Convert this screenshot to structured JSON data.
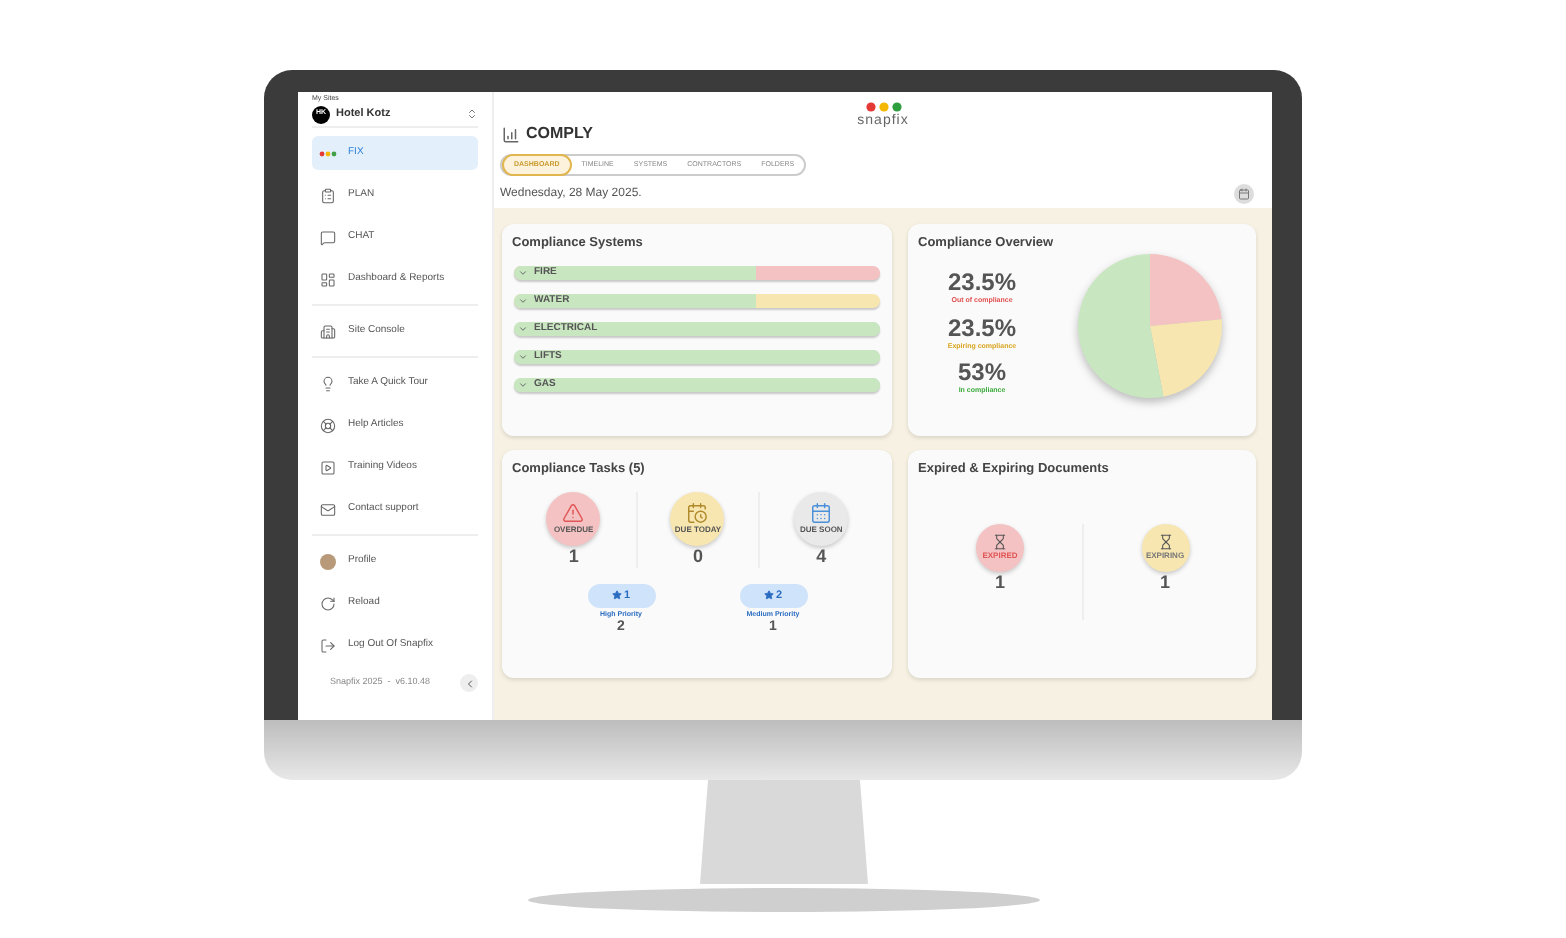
{
  "sidebar": {
    "site_label": "My Sites",
    "site_avatar": "HK",
    "site_name": "Hotel Kotz",
    "nav_groups": [
      [
        {
          "label": "FIX",
          "selected": true
        },
        {
          "label": "PLAN",
          "selected": false
        },
        {
          "label": "CHAT",
          "selected": false
        },
        {
          "label": "Dashboard & Reports",
          "selected": false
        }
      ],
      [
        {
          "label": "Site Console",
          "selected": false
        }
      ],
      [
        {
          "label": "Take A Quick Tour",
          "selected": false
        },
        {
          "label": "Help Articles",
          "selected": false
        },
        {
          "label": "Training Videos",
          "selected": false
        },
        {
          "label": "Contact support",
          "selected": false
        }
      ],
      [
        {
          "label": "Profile",
          "selected": false
        },
        {
          "label": "Reload",
          "selected": false
        },
        {
          "label": "Log Out Of Snapfix",
          "selected": false
        }
      ]
    ],
    "footer": "Snapfix 2025  -  v6.10.48"
  },
  "logo": {
    "wordmark": "snapfix"
  },
  "page_title": "COMPLY",
  "tabs": [
    {
      "label": "DASHBOARD",
      "selected": true
    },
    {
      "label": "TIMELINE",
      "selected": false
    },
    {
      "label": "SYSTEMS",
      "selected": false
    },
    {
      "label": "CONTRACTORS",
      "selected": false
    },
    {
      "label": "FOLDERS",
      "selected": false
    }
  ],
  "date": "Wednesday, 28 May 2025.",
  "systems": {
    "title": "Compliance Systems",
    "rows": [
      {
        "name": "FIRE",
        "level": 0.66,
        "color": "#f4c2c2"
      },
      {
        "name": "WATER",
        "level": 0.66,
        "color": "#f7e6b0"
      },
      {
        "name": "ELECTRICAL",
        "level": 1,
        "color": "#c8e6c0"
      },
      {
        "name": "LIFTS",
        "level": 1,
        "color": "#c8e6c0"
      },
      {
        "name": "GAS",
        "level": 1,
        "color": "#c8e6c0"
      }
    ]
  },
  "overview": {
    "title": "Compliance Overview",
    "stats": [
      {
        "value": "23.5%",
        "label": "Out of compliance",
        "color": "#e04f4f"
      },
      {
        "value": "23.5%",
        "label": "Expiring compliance",
        "color": "#d9a521"
      },
      {
        "value": "53%",
        "label": "In compliance",
        "color": "#3caa3c"
      }
    ]
  },
  "tasks": {
    "title": "Compliance Tasks (5)",
    "tiles": [
      {
        "label": "OVERDUE",
        "count": "1",
        "color": "#f4c2c2"
      },
      {
        "label": "DUE TODAY",
        "count": "0",
        "color": "#f7e6b0"
      },
      {
        "label": "DUE SOON",
        "count": "4",
        "color": "#e9e9e9"
      }
    ],
    "priorities": [
      {
        "badge": "1",
        "label": "High Priority",
        "count": "2"
      },
      {
        "badge": "2",
        "label": "Medium Priority",
        "count": "1"
      }
    ]
  },
  "documents": {
    "title": "Expired & Expiring Documents",
    "tiles": [
      {
        "label": "EXPIRED",
        "count": "1",
        "color": "#f4c2c2"
      },
      {
        "label": "EXPIRING",
        "count": "1",
        "color": "#f7e6b0"
      }
    ]
  }
}
